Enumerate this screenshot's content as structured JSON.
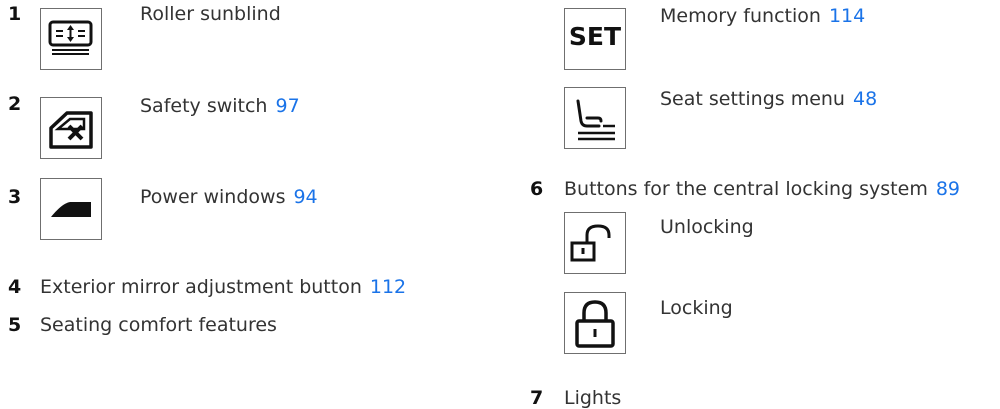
{
  "items": [
    {
      "num": "1",
      "label": "Roller sunblind",
      "ref": "",
      "icon": "roller-sunblind-icon"
    },
    {
      "num": "2",
      "label": "Safety switch",
      "ref": "97",
      "icon": "safety-switch-icon"
    },
    {
      "num": "3",
      "label": "Power windows",
      "ref": "94",
      "icon": "power-window-icon"
    },
    {
      "num": "4",
      "label": "Exterior mirror adjustment button",
      "ref": "112"
    },
    {
      "num": "5",
      "label": "Seating comfort features",
      "ref": ""
    }
  ],
  "right": {
    "memory": {
      "icon_text": "SET",
      "label": "Memory function",
      "ref": "114"
    },
    "seat_menu": {
      "label": "Seat settings menu",
      "ref": "48",
      "icon": "seat-settings-icon"
    },
    "item6": {
      "num": "6",
      "label": "Buttons for the central locking system",
      "ref": "89"
    },
    "unlocking": {
      "label": "Unlocking",
      "icon": "unlock-icon"
    },
    "locking": {
      "label": "Locking",
      "icon": "lock-icon"
    },
    "item7": {
      "num": "7",
      "label": "Lights"
    }
  }
}
